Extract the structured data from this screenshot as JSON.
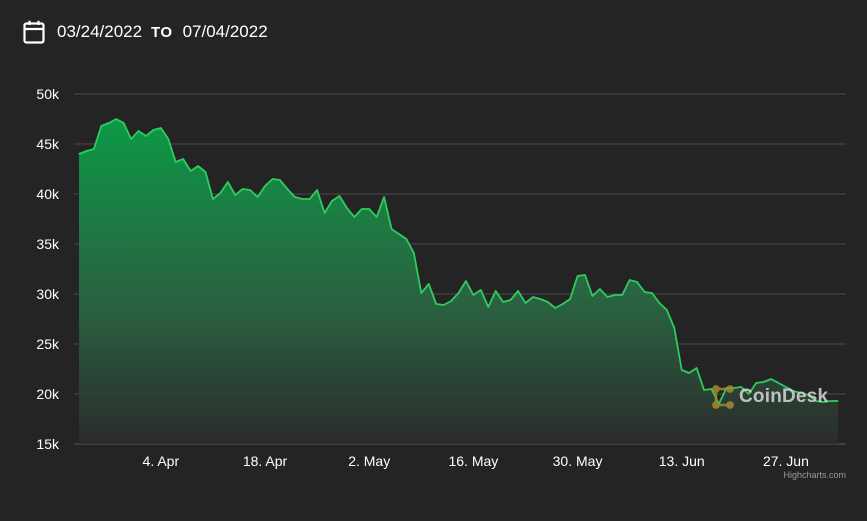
{
  "date_range": {
    "from": "03/24/2022",
    "to_label": "TO",
    "to": "07/04/2022"
  },
  "watermark": {
    "text": "CoinDesk"
  },
  "credit": "Highcharts.com",
  "colors": {
    "background": "#242424",
    "line": "#2ecc5f",
    "area_top": "#0b9a45",
    "grid": "#4a4a4a",
    "axis_text": "#ffffff"
  },
  "chart_data": {
    "type": "area",
    "title": "",
    "xlabel": "",
    "ylabel": "",
    "ylim": [
      15000,
      50000
    ],
    "xlim": [
      "2022-03-24",
      "2022-07-04"
    ],
    "y_ticks": [
      {
        "value": 15000,
        "label": "15k"
      },
      {
        "value": 20000,
        "label": "20k"
      },
      {
        "value": 25000,
        "label": "25k"
      },
      {
        "value": 30000,
        "label": "30k"
      },
      {
        "value": 35000,
        "label": "35k"
      },
      {
        "value": 40000,
        "label": "40k"
      },
      {
        "value": 45000,
        "label": "45k"
      },
      {
        "value": 50000,
        "label": "50k"
      }
    ],
    "x_ticks": [
      {
        "date": "2022-04-04",
        "label": "4. Apr"
      },
      {
        "date": "2022-04-18",
        "label": "18. Apr"
      },
      {
        "date": "2022-05-02",
        "label": "2. May"
      },
      {
        "date": "2022-05-16",
        "label": "16. May"
      },
      {
        "date": "2022-05-30",
        "label": "30. May"
      },
      {
        "date": "2022-06-13",
        "label": "13. Jun"
      },
      {
        "date": "2022-06-27",
        "label": "27. Jun"
      }
    ],
    "grid": true,
    "legend": "none",
    "series": [
      {
        "points": [
          [
            "2022-03-24",
            44000
          ],
          [
            "2022-03-25",
            44300
          ],
          [
            "2022-03-26",
            44500
          ],
          [
            "2022-03-27",
            46800
          ],
          [
            "2022-03-28",
            47100
          ],
          [
            "2022-03-29",
            47500
          ],
          [
            "2022-03-30",
            47100
          ],
          [
            "2022-03-31",
            45500
          ],
          [
            "2022-04-01",
            46300
          ],
          [
            "2022-04-02",
            45800
          ],
          [
            "2022-04-03",
            46400
          ],
          [
            "2022-04-04",
            46600
          ],
          [
            "2022-04-05",
            45500
          ],
          [
            "2022-04-06",
            43200
          ],
          [
            "2022-04-07",
            43500
          ],
          [
            "2022-04-08",
            42300
          ],
          [
            "2022-04-09",
            42800
          ],
          [
            "2022-04-10",
            42200
          ],
          [
            "2022-04-11",
            39500
          ],
          [
            "2022-04-12",
            40100
          ],
          [
            "2022-04-13",
            41200
          ],
          [
            "2022-04-14",
            39900
          ],
          [
            "2022-04-15",
            40500
          ],
          [
            "2022-04-16",
            40400
          ],
          [
            "2022-04-17",
            39700
          ],
          [
            "2022-04-18",
            40800
          ],
          [
            "2022-04-19",
            41500
          ],
          [
            "2022-04-20",
            41400
          ],
          [
            "2022-04-21",
            40500
          ],
          [
            "2022-04-22",
            39700
          ],
          [
            "2022-04-23",
            39500
          ],
          [
            "2022-04-24",
            39500
          ],
          [
            "2022-04-25",
            40400
          ],
          [
            "2022-04-26",
            38100
          ],
          [
            "2022-04-27",
            39300
          ],
          [
            "2022-04-28",
            39800
          ],
          [
            "2022-04-29",
            38600
          ],
          [
            "2022-04-30",
            37700
          ],
          [
            "2022-05-01",
            38500
          ],
          [
            "2022-05-02",
            38500
          ],
          [
            "2022-05-03",
            37700
          ],
          [
            "2022-05-04",
            39700
          ],
          [
            "2022-05-05",
            36500
          ],
          [
            "2022-05-06",
            36000
          ],
          [
            "2022-05-07",
            35500
          ],
          [
            "2022-05-08",
            34100
          ],
          [
            "2022-05-09",
            30100
          ],
          [
            "2022-05-10",
            31000
          ],
          [
            "2022-05-11",
            29000
          ],
          [
            "2022-05-12",
            28900
          ],
          [
            "2022-05-13",
            29300
          ],
          [
            "2022-05-14",
            30100
          ],
          [
            "2022-05-15",
            31300
          ],
          [
            "2022-05-16",
            29900
          ],
          [
            "2022-05-17",
            30400
          ],
          [
            "2022-05-18",
            28700
          ],
          [
            "2022-05-19",
            30300
          ],
          [
            "2022-05-20",
            29200
          ],
          [
            "2022-05-21",
            29400
          ],
          [
            "2022-05-22",
            30300
          ],
          [
            "2022-05-23",
            29100
          ],
          [
            "2022-05-24",
            29700
          ],
          [
            "2022-05-25",
            29500
          ],
          [
            "2022-05-26",
            29200
          ],
          [
            "2022-05-27",
            28600
          ],
          [
            "2022-05-28",
            29000
          ],
          [
            "2022-05-29",
            29500
          ],
          [
            "2022-05-30",
            31800
          ],
          [
            "2022-05-31",
            31900
          ],
          [
            "2022-06-01",
            29800
          ],
          [
            "2022-06-02",
            30500
          ],
          [
            "2022-06-03",
            29700
          ],
          [
            "2022-06-04",
            29900
          ],
          [
            "2022-06-05",
            29900
          ],
          [
            "2022-06-06",
            31400
          ],
          [
            "2022-06-07",
            31200
          ],
          [
            "2022-06-08",
            30200
          ],
          [
            "2022-06-09",
            30100
          ],
          [
            "2022-06-10",
            29100
          ],
          [
            "2022-06-11",
            28400
          ],
          [
            "2022-06-12",
            26600
          ],
          [
            "2022-06-13",
            22400
          ],
          [
            "2022-06-14",
            22100
          ],
          [
            "2022-06-15",
            22600
          ],
          [
            "2022-06-16",
            20400
          ],
          [
            "2022-06-17",
            20500
          ],
          [
            "2022-06-18",
            19000
          ],
          [
            "2022-06-19",
            20600
          ],
          [
            "2022-06-20",
            20600
          ],
          [
            "2022-06-21",
            20700
          ],
          [
            "2022-06-22",
            20000
          ],
          [
            "2022-06-23",
            21100
          ],
          [
            "2022-06-24",
            21200
          ],
          [
            "2022-06-25",
            21500
          ],
          [
            "2022-06-26",
            21100
          ],
          [
            "2022-06-27",
            20700
          ],
          [
            "2022-06-28",
            20300
          ],
          [
            "2022-06-29",
            20100
          ],
          [
            "2022-06-30",
            19900
          ],
          [
            "2022-07-01",
            19300
          ],
          [
            "2022-07-02",
            19200
          ],
          [
            "2022-07-03",
            19300
          ],
          [
            "2022-07-04",
            19300
          ]
        ]
      }
    ]
  }
}
